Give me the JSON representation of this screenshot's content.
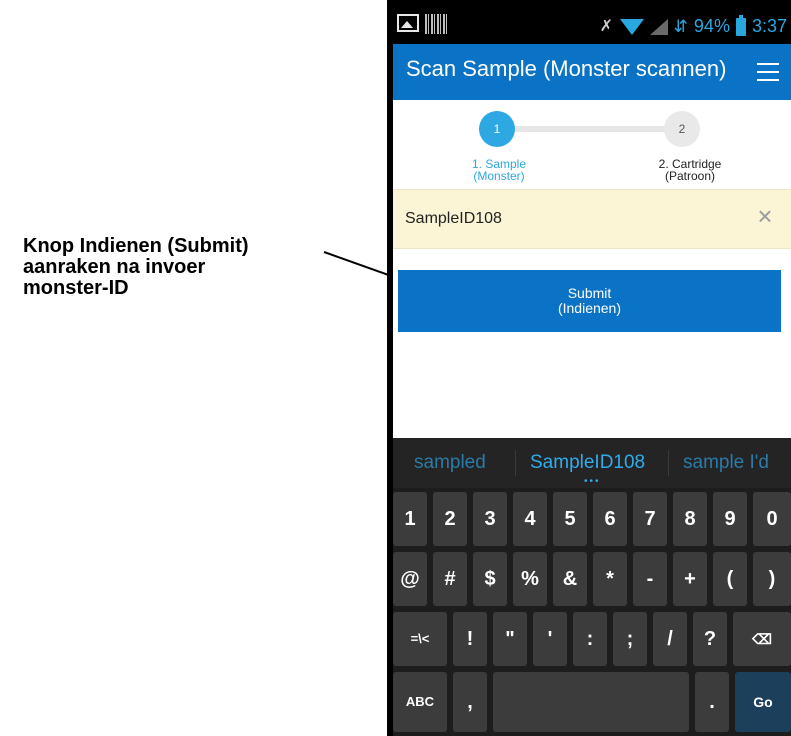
{
  "callout": {
    "lines": [
      "Knop Indienen (Submit)",
      "aanraken na invoer",
      "monster-ID"
    ]
  },
  "status_bar": {
    "battery": "94%",
    "time": "3:37",
    "icons": [
      "picture-icon",
      "barcode-icon",
      "mute-icon",
      "wifi-icon",
      "signal-icon",
      "network-icon",
      "battery-icon"
    ]
  },
  "app_bar": {
    "title": "Scan Sample",
    "title_translation": "(Monster scannen)",
    "menu_icon": "hamburger-menu-icon"
  },
  "stepper": {
    "steps": [
      {
        "number": "1",
        "label": "1. Sample",
        "sublabel": "(Monster)",
        "active": true
      },
      {
        "number": "2",
        "label": "2. Cartridge",
        "sublabel": "(Patroon)",
        "active": false
      }
    ]
  },
  "sample_input": {
    "value": "SampleID108",
    "clear_icon": "close-icon"
  },
  "submit_button": {
    "label": "Submit",
    "label_translation": "(Indienen)"
  },
  "keyboard": {
    "suggestions": [
      "sampled",
      "SampleID108",
      "sample I'd"
    ],
    "rows": [
      [
        "1",
        "2",
        "3",
        "4",
        "5",
        "6",
        "7",
        "8",
        "9",
        "0"
      ],
      [
        "@",
        "#",
        "$",
        "%",
        "&",
        "*",
        "-",
        "+",
        "(",
        ")"
      ],
      [
        "=\\<",
        "!",
        "\"",
        "'",
        ":",
        ";",
        "/",
        "?",
        "backspace"
      ],
      [
        "ABC",
        ",",
        "space",
        ".",
        "Go"
      ]
    ]
  },
  "colors": {
    "accent": "#0a73c6",
    "step_active": "#2da8e3",
    "input_background": "#fbf5d6",
    "keyboard_background": "#1d1d1d"
  }
}
